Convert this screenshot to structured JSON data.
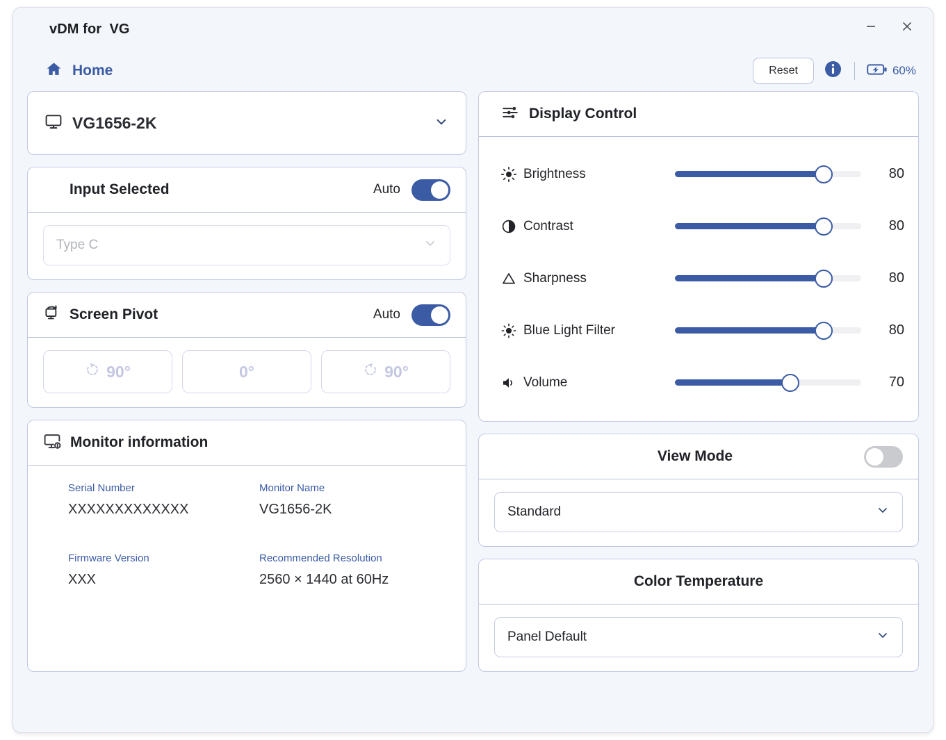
{
  "window": {
    "title": "vDM for  VG",
    "minimize_label": "minimize",
    "close_label": "close"
  },
  "nav": {
    "home_label": "Home",
    "reset_label": "Reset",
    "battery_percent": "60%",
    "accent_color": "#3b5ba5"
  },
  "monitor_selector": {
    "name": "VG1656-2K"
  },
  "input_selected": {
    "title": "Input Selected",
    "auto_label": "Auto",
    "auto_enabled": true,
    "value": "Type C"
  },
  "screen_pivot": {
    "title": "Screen Pivot",
    "auto_label": "Auto",
    "auto_enabled": true,
    "buttons": [
      {
        "label": "90°",
        "icon": "rotate-counterclockwise-icon"
      },
      {
        "label": "0°",
        "icon": "none"
      },
      {
        "label": "90°",
        "icon": "rotate-clockwise-icon"
      }
    ]
  },
  "monitor_information": {
    "title": "Monitor information",
    "fields": [
      {
        "label": "Serial Number",
        "value": "XXXXXXXXXXXXX"
      },
      {
        "label": "Monitor Name",
        "value": "VG1656-2K"
      },
      {
        "label": "Firmware Version",
        "value": "XXX"
      },
      {
        "label": "Recommended Resolution",
        "value": "2560 × 1440 at 60Hz"
      }
    ]
  },
  "display_control": {
    "title": "Display Control",
    "sliders": [
      {
        "label": "Brightness",
        "value": "80",
        "percent": 80,
        "icon": "sun-icon"
      },
      {
        "label": "Contrast",
        "value": "80",
        "percent": 80,
        "icon": "contrast-icon"
      },
      {
        "label": "Sharpness",
        "value": "80",
        "percent": 80,
        "icon": "triangle-icon"
      },
      {
        "label": "Blue Light Filter",
        "value": "80",
        "percent": 80,
        "icon": "blue-light-icon"
      },
      {
        "label": "Volume",
        "value": "70",
        "percent": 62,
        "icon": "speaker-icon"
      }
    ]
  },
  "view_mode": {
    "title": "View Mode",
    "enabled": false,
    "value": "Standard"
  },
  "color_temperature": {
    "title": "Color Temperature",
    "value": "Panel Default"
  }
}
